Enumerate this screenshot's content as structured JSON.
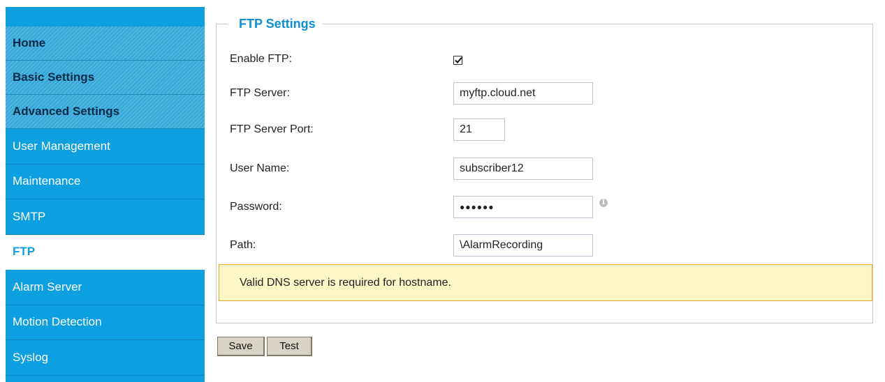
{
  "sidebar": {
    "items": [
      {
        "label": "Home",
        "type": "section"
      },
      {
        "label": "Basic Settings",
        "type": "section"
      },
      {
        "label": "Advanced Settings",
        "type": "section"
      },
      {
        "label": "User Management",
        "type": "sub"
      },
      {
        "label": "Maintenance",
        "type": "sub"
      },
      {
        "label": "SMTP",
        "type": "sub"
      },
      {
        "label": "FTP",
        "type": "active"
      },
      {
        "label": "Alarm Server",
        "type": "sub"
      },
      {
        "label": "Motion Detection",
        "type": "sub"
      },
      {
        "label": "Syslog",
        "type": "sub"
      }
    ]
  },
  "panel": {
    "legend": "FTP Settings",
    "enable_ftp": {
      "label": "Enable FTP:",
      "checked": true
    },
    "server": {
      "label": "FTP Server:",
      "value": "myftp.cloud.net"
    },
    "port": {
      "label": "FTP Server Port:",
      "value": "21"
    },
    "username": {
      "label": "User Name:",
      "value": "subscriber12"
    },
    "password": {
      "label": "Password:",
      "value": "●●●●●●"
    },
    "path": {
      "label": "Path:",
      "value": "\\AlarmRecording"
    },
    "info_icon": "info-icon",
    "notice": "Valid DNS server is required for hostname."
  },
  "buttons": {
    "save": "Save",
    "test": "Test"
  },
  "colors": {
    "sidebar": "#0d9fdf",
    "legend": "#0d8fd0",
    "notice_bg": "#fdf6c6",
    "notice_border": "#f0a528"
  }
}
